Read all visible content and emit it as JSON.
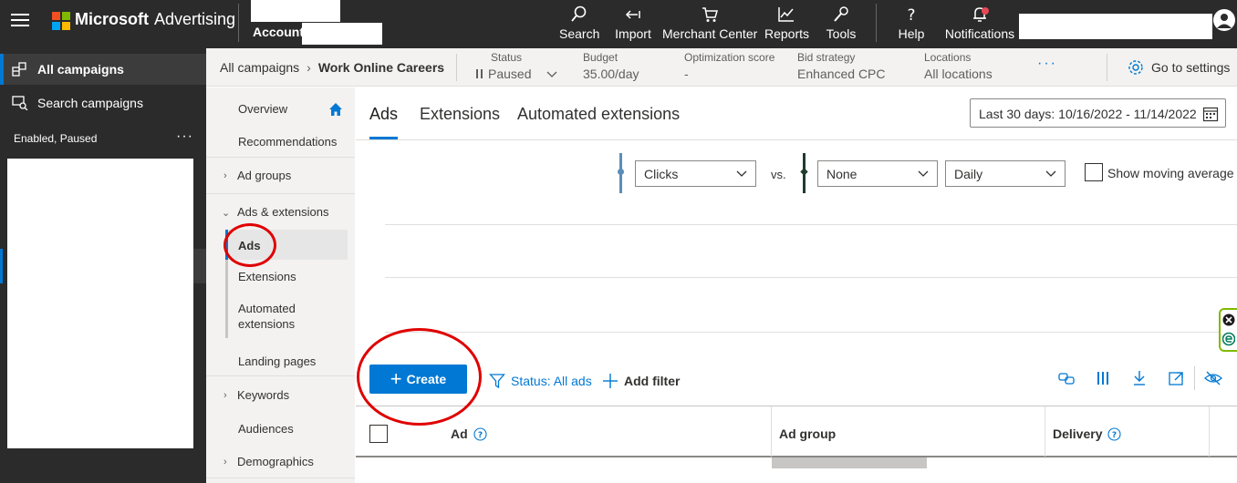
{
  "app": {
    "brand_bold": "Microsoft",
    "brand_light": "Advertising",
    "account_label": "Account"
  },
  "topnav": [
    {
      "label": "Search",
      "icon": "search-icon"
    },
    {
      "label": "Import",
      "icon": "import-icon"
    },
    {
      "label": "Merchant Center",
      "icon": "cart-icon"
    },
    {
      "label": "Reports",
      "icon": "chart-icon"
    },
    {
      "label": "Tools",
      "icon": "wrench-icon"
    },
    {
      "label": "Help",
      "icon": "help-icon"
    },
    {
      "label": "Notifications",
      "icon": "bell-icon"
    }
  ],
  "sidebar": {
    "items": [
      {
        "label": "All campaigns",
        "icon": "campaigns-icon"
      },
      {
        "label": "Search campaigns",
        "icon": "search-campaigns-icon"
      }
    ],
    "filter_label": "Enabled, Paused",
    "more": "···"
  },
  "header": {
    "breadcrumb_root": "All campaigns",
    "breadcrumb_sep": "›",
    "breadcrumb_current": "Work Online Careers",
    "fields": [
      {
        "label": "Status",
        "value": "Paused"
      },
      {
        "label": "Budget",
        "value": "35.00/day"
      },
      {
        "label": "Optimization score",
        "value": "-"
      },
      {
        "label": "Bid strategy",
        "value": "Enhanced CPC"
      },
      {
        "label": "Locations",
        "value": "All locations"
      }
    ],
    "more": "···",
    "settings_label": "Go to settings"
  },
  "subnav": {
    "overview": "Overview",
    "recommendations": "Recommendations",
    "ad_groups": "Ad groups",
    "ads_extensions": "Ads & extensions",
    "ads": "Ads",
    "extensions": "Extensions",
    "automated_1": "Automated",
    "automated_2": "extensions",
    "landing_pages": "Landing pages",
    "keywords": "Keywords",
    "audiences": "Audiences",
    "demographics": "Demographics"
  },
  "tabs": [
    "Ads",
    "Extensions",
    "Automated extensions"
  ],
  "date_range": "Last 30 days: 10/16/2022 - 11/14/2022",
  "chart": {
    "metric1": "Clicks",
    "vs": "vs.",
    "metric2": "None",
    "interval": "Daily",
    "moving_avg_label": "Show moving average",
    "colors": {
      "metric1": "#5b8db8",
      "metric2": "#1f3b2d"
    }
  },
  "toolbar": {
    "create_label": "Create",
    "status_filter": "Status: All ads",
    "add_filter": "Add filter"
  },
  "grid": {
    "columns": [
      "Ad",
      "Ad group",
      "Delivery"
    ]
  },
  "colors": {
    "accent": "#0078d4",
    "topbar": "#2b2b2b",
    "annotation": "#e00000"
  }
}
